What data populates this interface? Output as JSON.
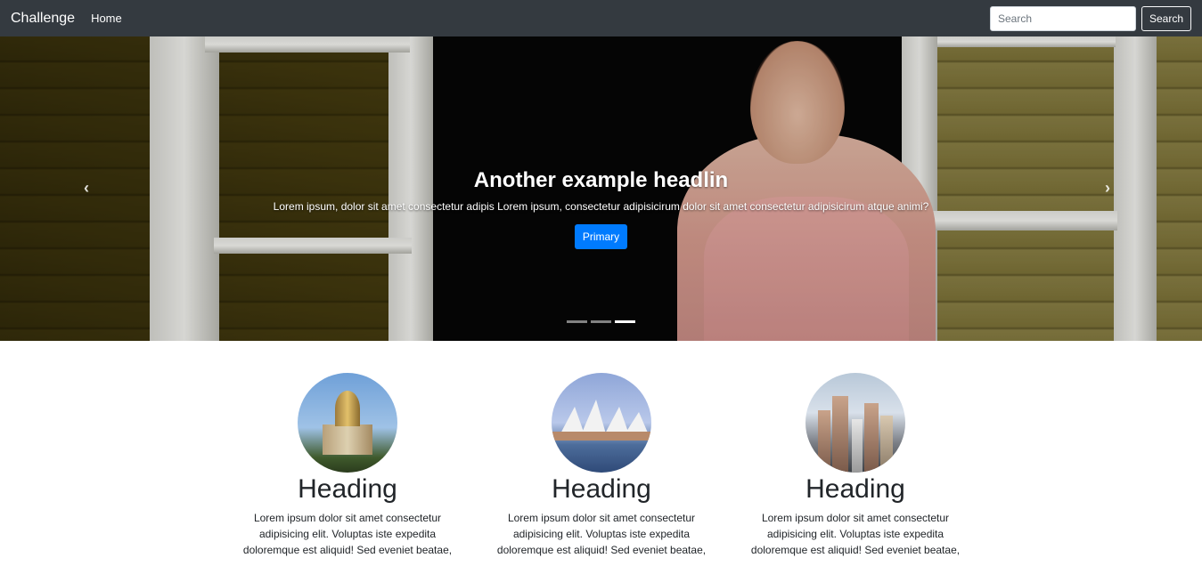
{
  "navbar": {
    "brand": "Challenge",
    "links": [
      "Home"
    ],
    "search_placeholder": "Search",
    "search_button": "Search"
  },
  "carousel": {
    "headline": "Another example headlin",
    "text": "Lorem ipsum, dolor sit amet consectetur adipis Lorem ipsum, consectetur adipisicirum dolor sit amet consectetur adipisicirum atque animi?",
    "button": "Primary",
    "prev_icon": "chevron-left-icon",
    "next_icon": "chevron-right-icon",
    "prev_glyph": "‹",
    "next_glyph": "›",
    "slide_count": 3,
    "active_slide": 3,
    "primary_color": "#007bff"
  },
  "marketing": {
    "columns": [
      {
        "heading": "Heading",
        "text": "Lorem ipsum dolor sit amet consectetur adipisicing elit. Voluptas iste expedita doloremque est aliquid! Sed eveniet beatae,"
      },
      {
        "heading": "Heading",
        "text": "Lorem ipsum dolor sit amet consectetur adipisicing elit. Voluptas iste expedita doloremque est aliquid! Sed eveniet beatae,"
      },
      {
        "heading": "Heading",
        "text": "Lorem ipsum dolor sit amet consectetur adipisicing elit. Voluptas iste expedita doloremque est aliquid! Sed eveniet beatae,"
      }
    ]
  }
}
